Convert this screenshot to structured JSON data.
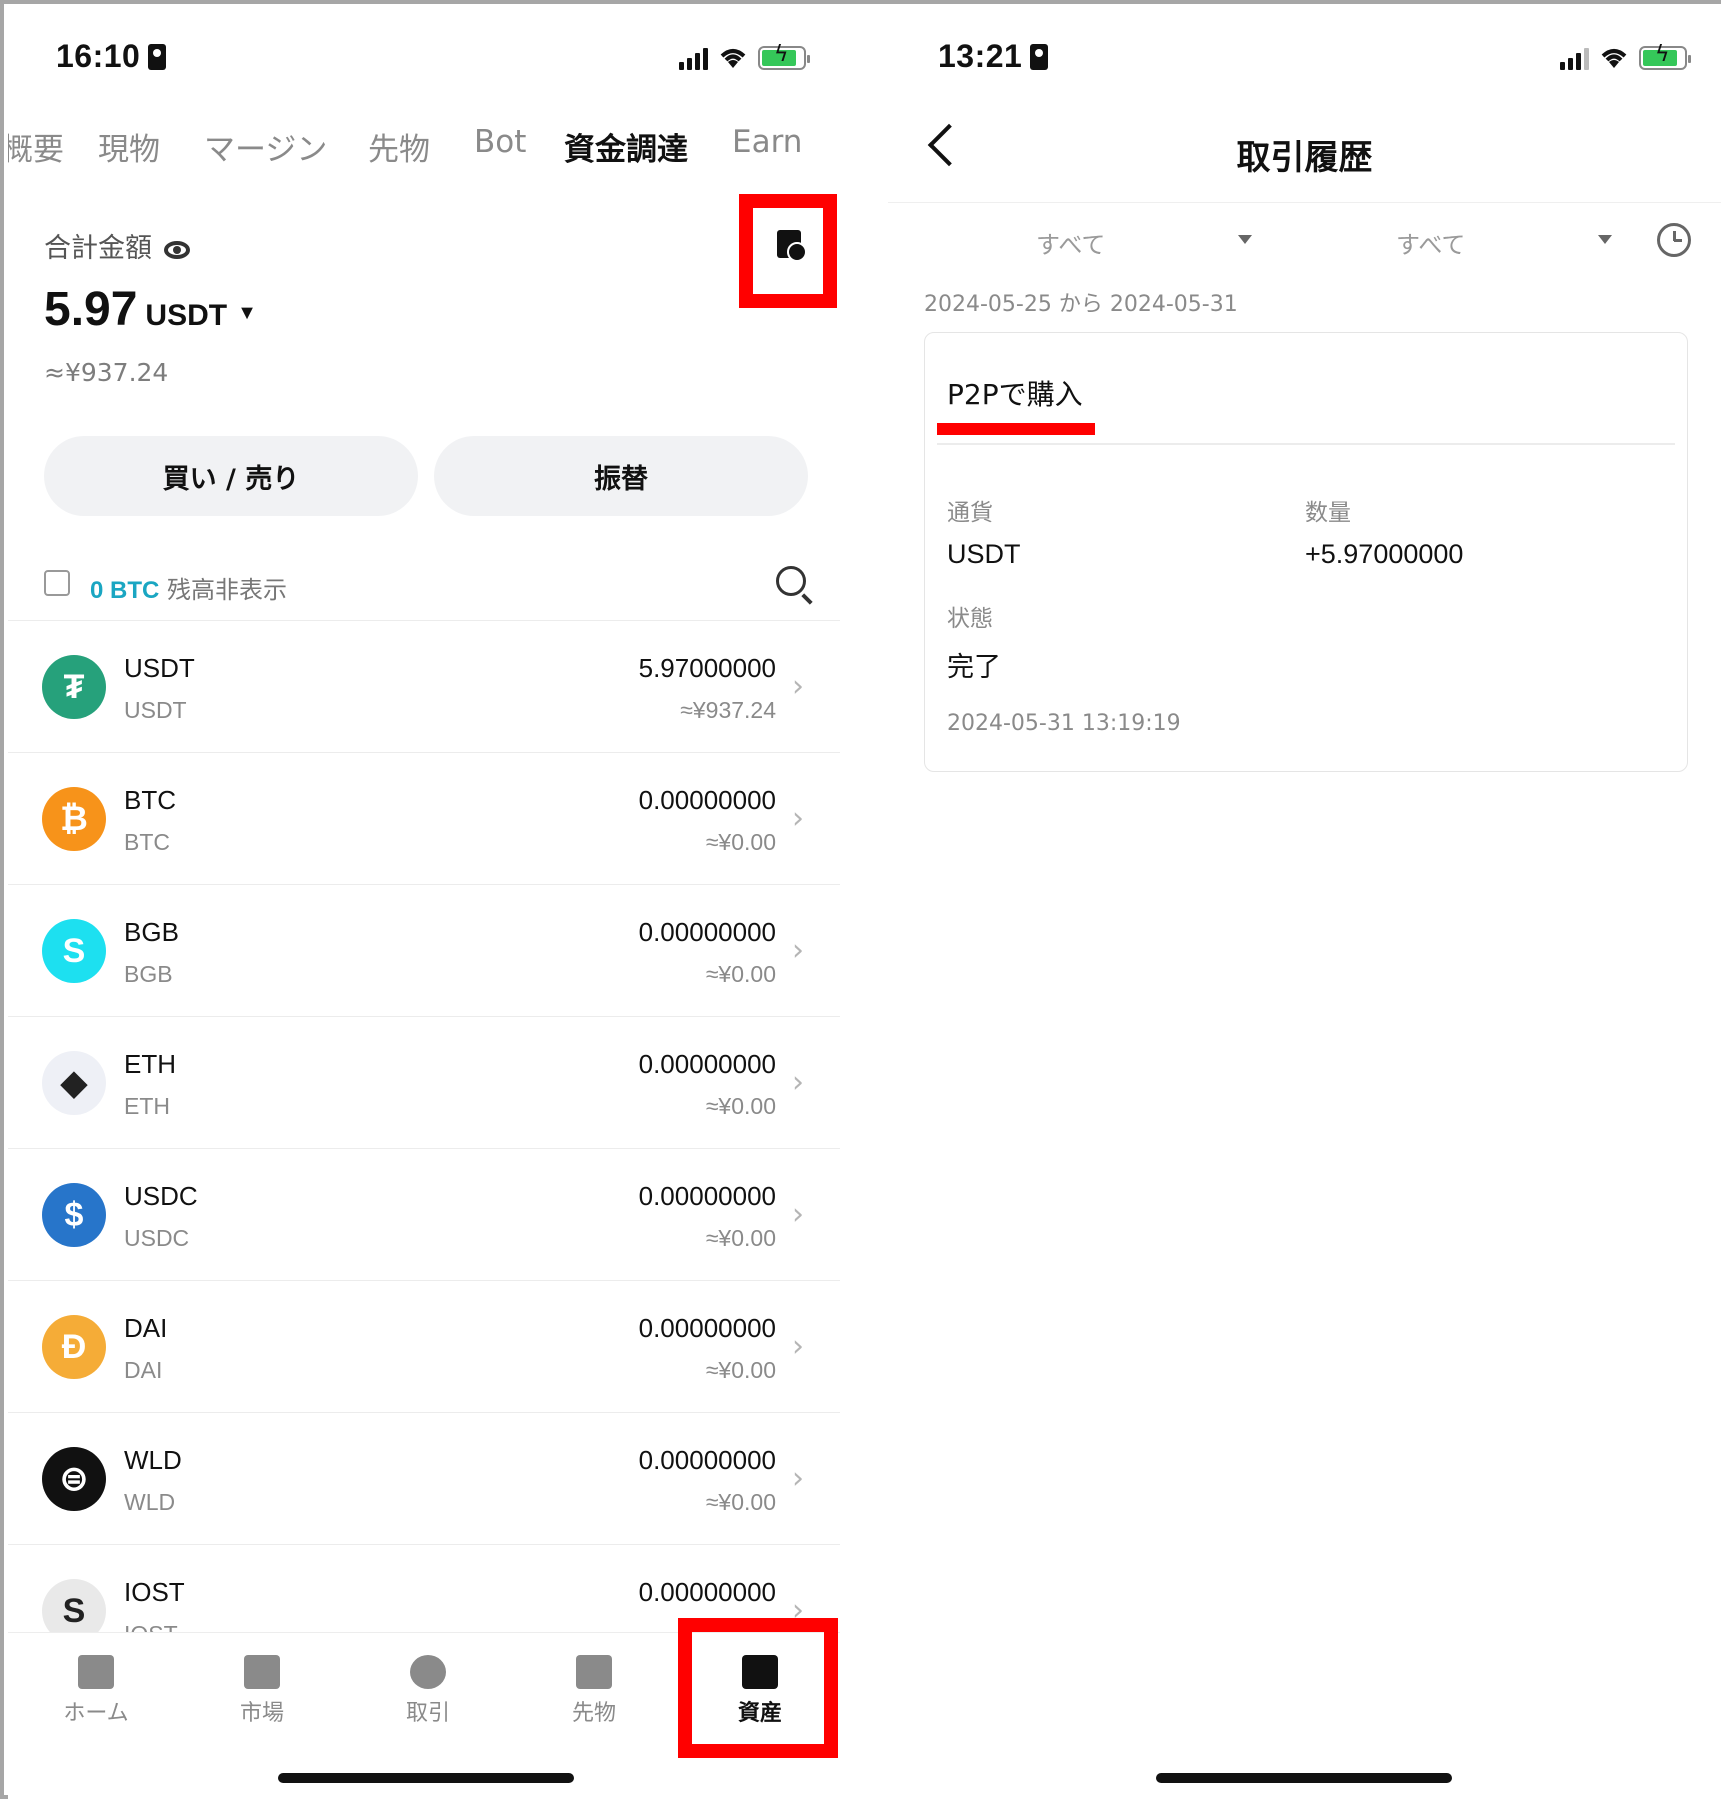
{
  "left": {
    "status": {
      "time": "16:10"
    },
    "tabs": [
      "概要",
      "現物",
      "マージン",
      "先物",
      "Bot",
      "資金調達",
      "Earn"
    ],
    "total": {
      "label": "合計金額",
      "amount": "5.97",
      "unit": "USDT",
      "caret": "▼",
      "fiat": "≈¥937.24"
    },
    "buttons": {
      "buy_sell": "買い / 売り",
      "transfer": "振替"
    },
    "hide_zero": {
      "highlight": "0 BTC",
      "label": " 残高非表示"
    },
    "assets": [
      {
        "symbol": "USDT",
        "sub": "USDT",
        "amount": "5.97000000",
        "fiat": "≈¥937.24",
        "icon": "₮",
        "color": "#26a17b"
      },
      {
        "symbol": "BTC",
        "sub": "BTC",
        "amount": "0.00000000",
        "fiat": "≈¥0.00",
        "icon": "₿",
        "color": "#f7931a"
      },
      {
        "symbol": "BGB",
        "sub": "BGB",
        "amount": "0.00000000",
        "fiat": "≈¥0.00",
        "icon": "S",
        "color": "#1de0f0"
      },
      {
        "symbol": "ETH",
        "sub": "ETH",
        "amount": "0.00000000",
        "fiat": "≈¥0.00",
        "icon": "◆",
        "color": "#eef0f6"
      },
      {
        "symbol": "USDC",
        "sub": "USDC",
        "amount": "0.00000000",
        "fiat": "≈¥0.00",
        "icon": "$",
        "color": "#2775ca"
      },
      {
        "symbol": "DAI",
        "sub": "DAI",
        "amount": "0.00000000",
        "fiat": "≈¥0.00",
        "icon": "Đ",
        "color": "#f5ac37"
      },
      {
        "symbol": "WLD",
        "sub": "WLD",
        "amount": "0.00000000",
        "fiat": "≈¥0.00",
        "icon": "⊜",
        "color": "#111111"
      },
      {
        "symbol": "IOST",
        "sub": "IOST",
        "amount": "0.00000000",
        "fiat": "",
        "icon": "S",
        "color": "#e9e9e9"
      }
    ],
    "nav": [
      "ホーム",
      "市場",
      "取引",
      "先物",
      "資産"
    ]
  },
  "right": {
    "status": {
      "time": "13:21"
    },
    "title": "取引履歴",
    "filters": [
      "すべて",
      "すべて"
    ],
    "date_range": "2024-05-25  から  2024-05-31",
    "record": {
      "title": "P2Pで購入",
      "currency_label": "通貨",
      "currency": "USDT",
      "qty_label": "数量",
      "qty": "+5.97000000",
      "state_label": "状態",
      "state": "完了",
      "timestamp": "2024-05-31 13:19:19"
    }
  },
  "colors": {
    "highlight": "#ff0000",
    "accent_teal": "#1aa6c2"
  }
}
